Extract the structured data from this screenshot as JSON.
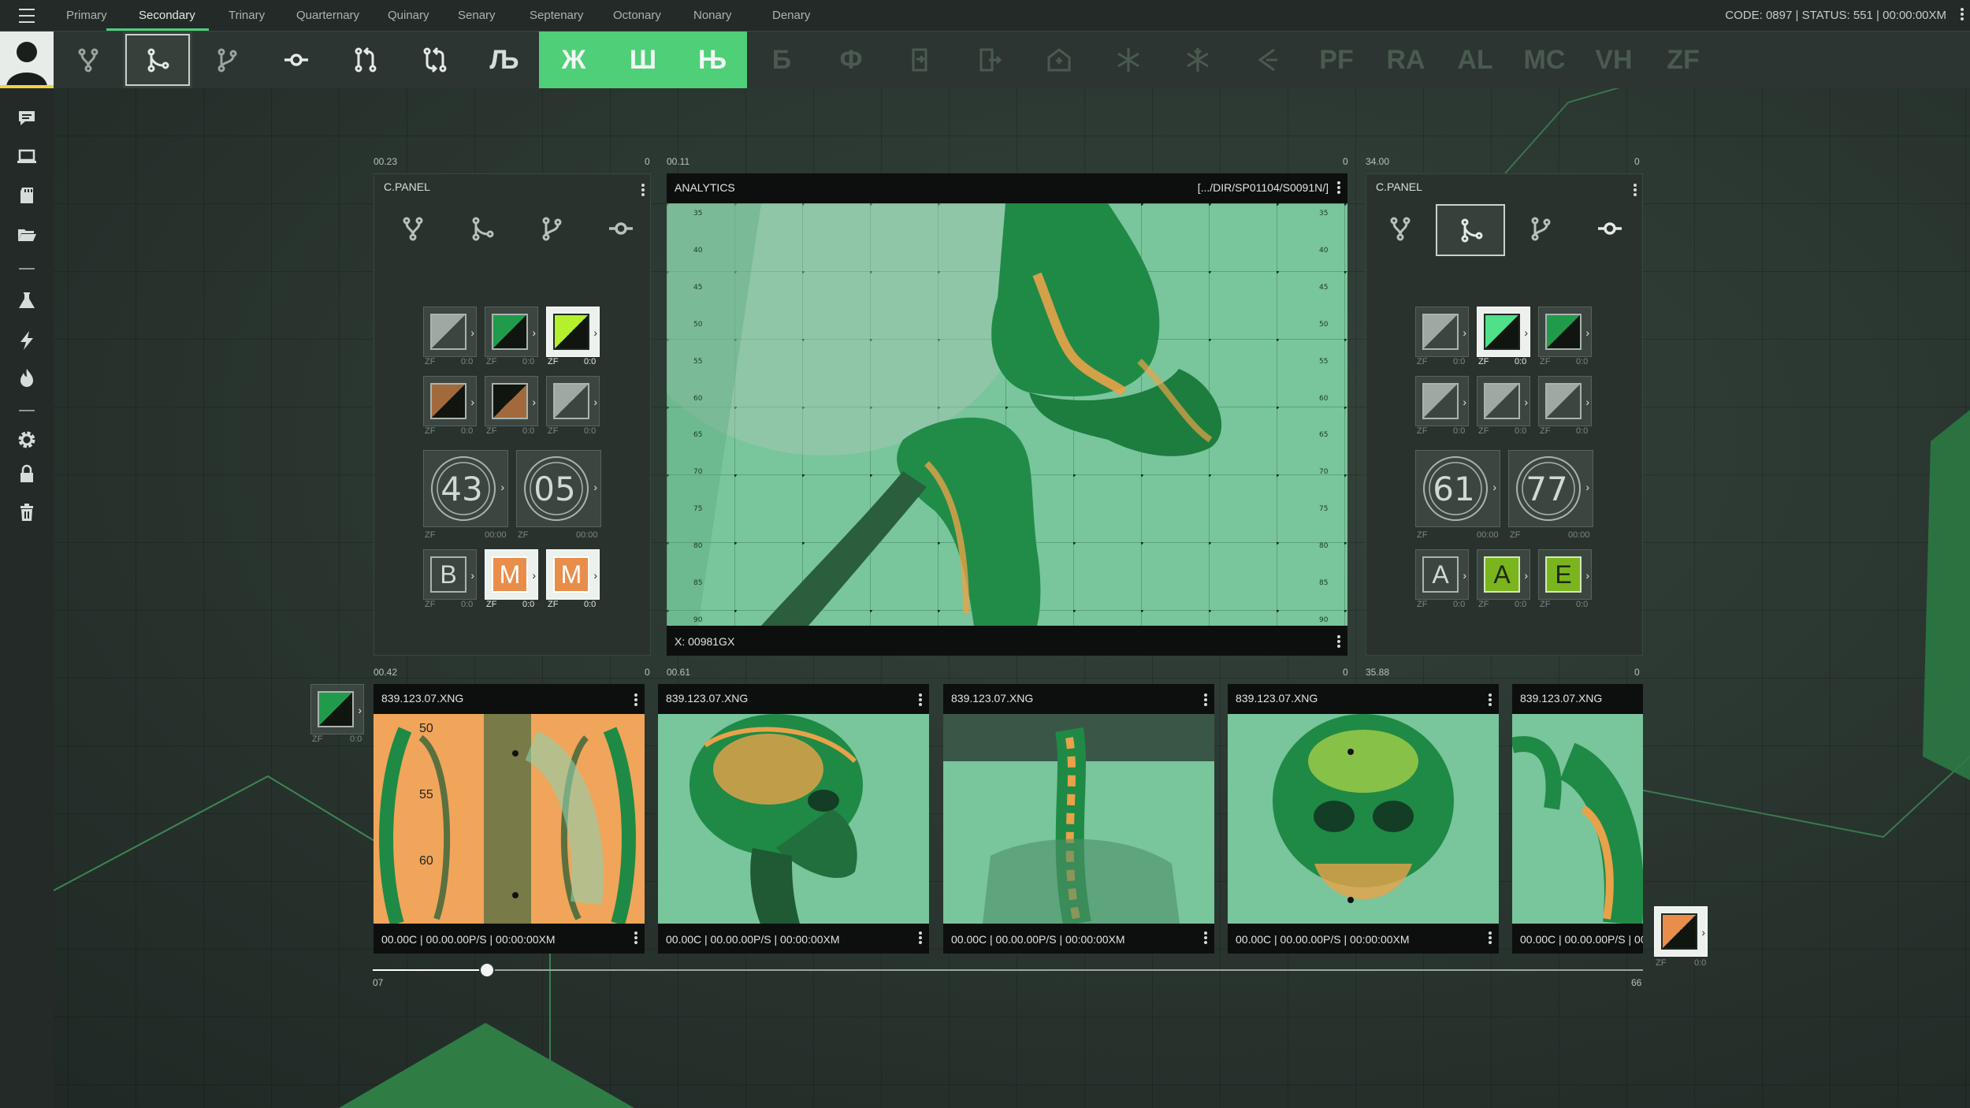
{
  "nav": {
    "tabs": [
      "Primary",
      "Secondary",
      "Trinary",
      "Quarternary",
      "Quinary",
      "Senary",
      "Septenary",
      "Octonary",
      "Nonary",
      "Denary"
    ],
    "active_tab": "Secondary",
    "status": "CODE: 0897 | STATUS: 551 | 00:00:00XM"
  },
  "toolbar": {
    "icons": [
      "fork-icon",
      "branch-selected-icon",
      "merge-icon",
      "commit-icon",
      "pull-request-icon",
      "sync-icon"
    ],
    "glyphs": [
      "Љ",
      "Ж",
      "Ш",
      "Њ",
      "Б",
      "Ф"
    ],
    "more_icons": [
      "door-exit-icon",
      "door-exit-alt-icon",
      "hospital-icon",
      "snowflake-icon",
      "snowflake-alt-icon",
      "scorpio-icon"
    ],
    "abbr": [
      "PF",
      "RA",
      "AL",
      "MC",
      "VH",
      "ZF"
    ],
    "accent": "#4fcf78"
  },
  "sidebar": {
    "icons": [
      "chat-icon",
      "laptop-icon",
      "sd-card-icon",
      "folder-open-icon",
      "flask-icon",
      "bolt-icon",
      "fire-icon",
      "gear-icon",
      "lock-icon",
      "trash-icon"
    ]
  },
  "left_panel": {
    "title": "C.PANEL",
    "top_left": "00.23",
    "top_right": "0",
    "tile_caption_left": "ZF",
    "tile_caption_right": "0:0",
    "dial_values": [
      "43",
      "05"
    ],
    "dial_caption_right": "00:00",
    "letters": [
      "B",
      "M",
      "M"
    ]
  },
  "analytics": {
    "title": "ANALYTICS",
    "path": "[.../DIR/SP01104/S0091N/]",
    "footer": "X: 00981GX",
    "top_left": "00.11",
    "top_right": "0",
    "scale_labels": [
      "35",
      "40",
      "45",
      "50",
      "55",
      "60",
      "65",
      "70",
      "75",
      "80",
      "85",
      "90"
    ]
  },
  "right_panel": {
    "title": "C.PANEL",
    "top_left": "34.00",
    "top_right": "0",
    "tile_caption_left": "ZF",
    "tile_caption_right": "0:0",
    "dial_values": [
      "61",
      "77"
    ],
    "dial_caption_right": "00:00",
    "letters": [
      "A",
      "A",
      "E"
    ]
  },
  "strip": {
    "left_label": "00.42",
    "left_right": "0",
    "mid_label": "00.61",
    "mid_right": "0",
    "right_label": "35.88",
    "right_right": "0",
    "side_tile_left": "ZF",
    "side_tile_right": "0:0",
    "thumbs": [
      {
        "name": "839.123.07.XNG",
        "footer": "00.00C | 00.00.00P/S | 00:00:00XM",
        "labels": [
          "50",
          "55",
          "60"
        ]
      },
      {
        "name": "839.123.07.XNG",
        "footer": "00.00C | 00.00.00P/S | 00:00:00XM"
      },
      {
        "name": "839.123.07.XNG",
        "footer": "00.00C | 00.00.00P/S | 00:00:00XM"
      },
      {
        "name": "839.123.07.XNG",
        "footer": "00.00C | 00.00.00P/S | 00:00:00XM"
      },
      {
        "name": "839.123.07.XNG",
        "footer": "00.00C | 00.00.00P/S | 00:0"
      }
    ]
  },
  "slider": {
    "min": "07",
    "max": "66",
    "value": 0.09
  },
  "colors": {
    "orange": "#f0a55a",
    "green": "#1f9b4b",
    "lime": "#b5f02c",
    "mint": "#6fc59a"
  }
}
